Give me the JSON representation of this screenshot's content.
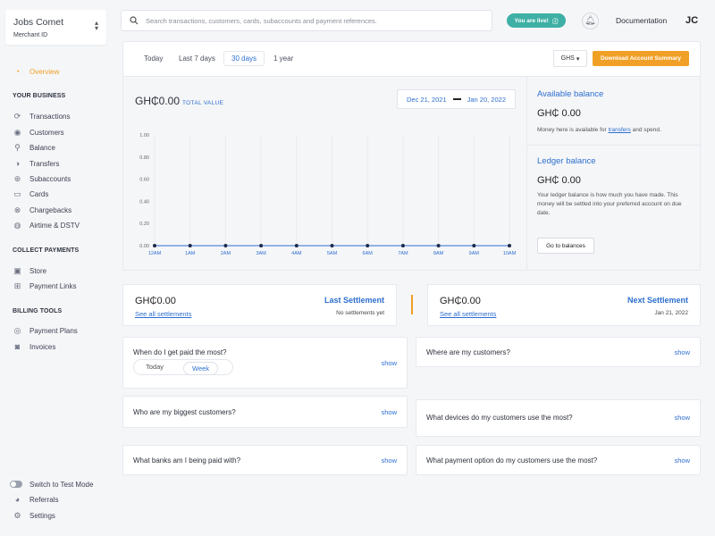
{
  "merchant": {
    "name": "Jobs Comet",
    "id_label": "Merchant ID"
  },
  "sidebar": {
    "overview": "Overview",
    "sections": [
      {
        "title": "YOUR BUSINESS",
        "items": [
          "Transactions",
          "Customers",
          "Balance",
          "Transfers",
          "Subaccounts",
          "Cards",
          "Chargebacks",
          "Airtime & DSTV"
        ]
      },
      {
        "title": "COLLECT PAYMENTS",
        "items": [
          "Store",
          "Payment Links"
        ]
      },
      {
        "title": "BILLING TOOLS",
        "items": [
          "Payment Plans",
          "Invoices"
        ]
      }
    ],
    "bottom": {
      "test_mode": "Switch to Test Mode",
      "referrals": "Referrals",
      "settings": "Settings"
    }
  },
  "topbar": {
    "search_placeholder": "Search transactions, customers, cards, subaccounts and payment references.",
    "live_badge": "You are live!",
    "documentation": "Documentation",
    "avatar": "JC"
  },
  "period": {
    "tabs": [
      "Today",
      "Last 7 days",
      "30 days",
      "1 year"
    ],
    "active": "30 days",
    "currency": "GHS",
    "download": "Download Account Summary"
  },
  "chart": {
    "total_amount": "GH₵0.00",
    "total_label": "TOTAL VALUE",
    "date_start": "Dec 21, 2021",
    "date_end": "Jan 20, 2022"
  },
  "chart_data": {
    "type": "line",
    "x": [
      "12AM",
      "1AM",
      "2AM",
      "3AM",
      "4AM",
      "5AM",
      "6AM",
      "7AM",
      "8AM",
      "9AM",
      "10AM"
    ],
    "series": [
      {
        "values": [
          0,
          0,
          0,
          0,
          0,
          0,
          0,
          0,
          0,
          0,
          0
        ]
      }
    ],
    "y_ticks": [
      "0.00",
      "0.20",
      "0.40",
      "0.60",
      "0.80",
      "1.00"
    ],
    "ylim": [
      0,
      1
    ],
    "grid": true,
    "line_color": "#2d6fcf",
    "point_color": "#1f2a4a"
  },
  "balances": {
    "available_title": "Available balance",
    "available_amount": "GH₵ 0.00",
    "available_note_pre": "Money here is available for ",
    "available_note_link": "transfers",
    "available_note_post": " and spend.",
    "ledger_title": "Ledger balance",
    "ledger_amount": "GH₵ 0.00",
    "ledger_note": "Your ledger balance is how much you have made. This money will be settled into your preferred account on due date.",
    "goto_button": "Go to balances"
  },
  "settlements": {
    "last": {
      "amount": "GH₵0.00",
      "link": "See all settlements",
      "title": "Last Settlement",
      "sub": "No settlements yet"
    },
    "next": {
      "amount": "GH₵0.00",
      "link": "See all settlements",
      "title": "Next Settlement",
      "sub": "Jan 21, 2022"
    }
  },
  "questions": {
    "paid_most": "When do I get paid the most?",
    "where_customers": "Where are my customers?",
    "biggest_customers": "Who are my biggest customers?",
    "devices": "What devices do my customers use the most?",
    "banks": "What banks am I being paid with?",
    "payment_option": "What payment option do my customers use the most?",
    "show": "show",
    "seg_today": "Today",
    "seg_week": "Week"
  },
  "colors": {
    "accent": "#2d6fcf",
    "orange": "#f0a026",
    "live": "#3fb0a5"
  }
}
